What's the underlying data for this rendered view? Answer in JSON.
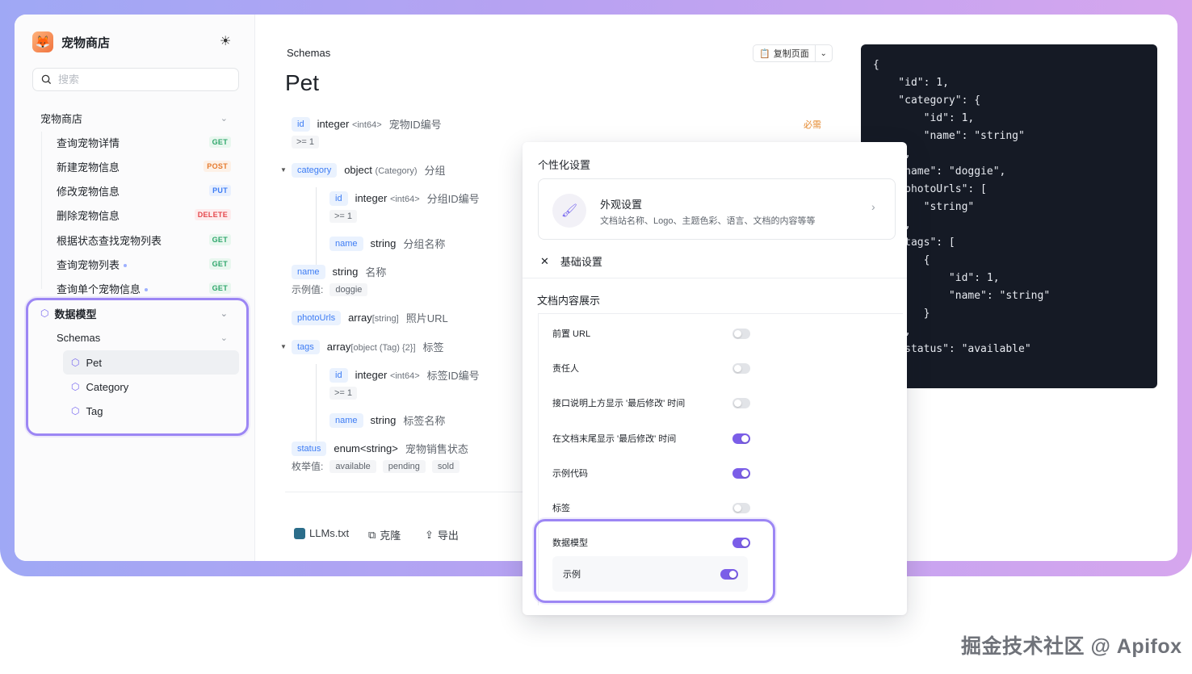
{
  "sidebar": {
    "brand": "宠物商店",
    "search_placeholder": "搜索",
    "group_label": "宠物商店",
    "items": [
      {
        "label": "查询宠物详情",
        "method": "GET"
      },
      {
        "label": "新建宠物信息",
        "method": "POST"
      },
      {
        "label": "修改宠物信息",
        "method": "PUT"
      },
      {
        "label": "删除宠物信息",
        "method": "DELETE"
      },
      {
        "label": "根据状态查找宠物列表",
        "method": "GET"
      },
      {
        "label": "查询宠物列表",
        "method": "GET"
      },
      {
        "label": "查询单个宠物信息",
        "method": "GET"
      }
    ],
    "models_label": "数据模型",
    "schemas_label": "Schemas",
    "schema_items": [
      "Pet",
      "Category",
      "Tag"
    ]
  },
  "content": {
    "breadcrumb": "Schemas",
    "title": "Pet",
    "copy_label": "复制页面",
    "required": "必需",
    "fields": {
      "id": {
        "name": "id",
        "type": "integer",
        "fmt": "<int64>",
        "desc": "宠物ID编号",
        "constraint": ">= 1"
      },
      "category": {
        "name": "category",
        "type": "object",
        "fmt": "(Category)",
        "desc": "分组"
      },
      "cat_id": {
        "name": "id",
        "type": "integer",
        "fmt": "<int64>",
        "desc": "分组ID编号",
        "constraint": ">= 1"
      },
      "cat_name": {
        "name": "name",
        "type": "string",
        "desc": "分组名称"
      },
      "name": {
        "name": "name",
        "type": "string",
        "desc": "名称",
        "example_label": "示例值:",
        "example": "doggie"
      },
      "photo": {
        "name": "photoUrls",
        "type": "array",
        "fmt": "[string]",
        "desc": "照片URL"
      },
      "tags": {
        "name": "tags",
        "type": "array",
        "fmt": "[object (Tag) {2}]",
        "desc": "标签"
      },
      "tag_id": {
        "name": "id",
        "type": "integer",
        "fmt": "<int64>",
        "desc": "标签ID编号",
        "constraint": ">= 1"
      },
      "tag_name": {
        "name": "name",
        "type": "string",
        "desc": "标签名称"
      },
      "status": {
        "name": "status",
        "type": "enum<string>",
        "desc": "宠物销售状态",
        "enum_label": "枚举值:",
        "enum_values": [
          "available",
          "pending",
          "sold"
        ]
      }
    },
    "footer": {
      "llms": "LLMs.txt",
      "clone": "克隆",
      "export": "导出"
    }
  },
  "code": {
    "lines": [
      "{",
      "    \"id\": 1,",
      "    \"category\": {",
      "        \"id\": 1,",
      "        \"name\": \"string\"",
      "    },",
      "    \"name\": \"doggie\",",
      "    \"photoUrls\": [",
      "        \"string\"",
      "    ],",
      "    \"tags\": [",
      "        {",
      "            \"id\": 1,",
      "            \"name\": \"string\"",
      "        }",
      "    ],",
      "    \"status\": \"available\""
    ]
  },
  "panel": {
    "title": "个性化设置",
    "appearance_title": "外观设置",
    "appearance_desc": "文档站名称、Logo、主题色彩、语言、文档的内容等等",
    "basic_label": "基础设置",
    "section_title": "文档内容展示",
    "options": [
      {
        "label": "前置 URL",
        "on": false
      },
      {
        "label": "责任人",
        "on": false
      },
      {
        "label": "接口说明上方显示 '最后修改' 时间",
        "on": false
      },
      {
        "label": "在文档末尾显示 '最后修改' 时间",
        "on": true
      },
      {
        "label": "示例代码",
        "on": true
      },
      {
        "label": "标签",
        "on": false
      },
      {
        "label": "数据模型",
        "on": true
      }
    ],
    "sub_option": {
      "label": "示例",
      "on": true
    }
  },
  "watermark": "掘金技术社区 @ Apifox"
}
